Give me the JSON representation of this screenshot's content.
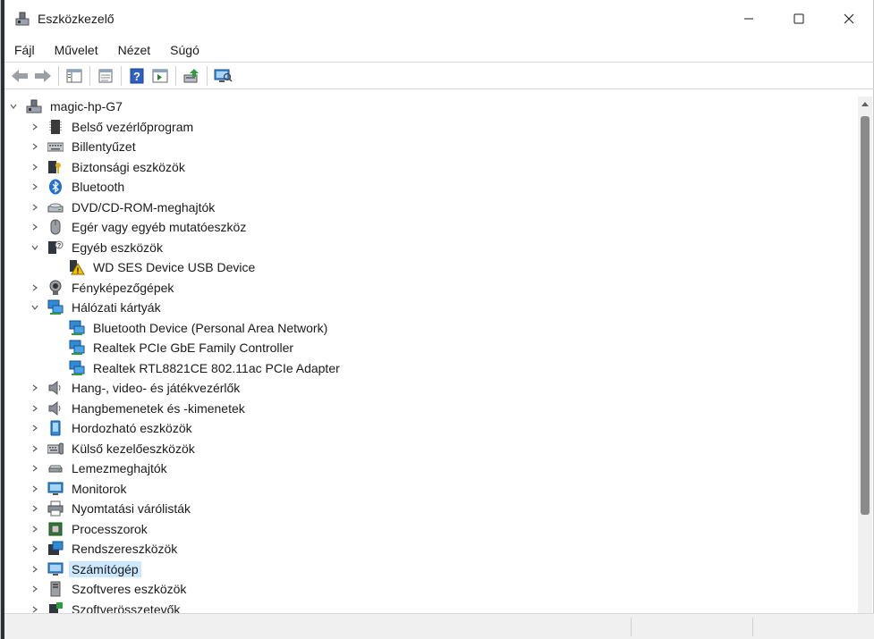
{
  "window": {
    "title": "Eszközkezelő",
    "icon": "device-manager-icon"
  },
  "window_controls": [
    "minimize-icon",
    "maximize-icon",
    "close-icon"
  ],
  "menu": [
    {
      "label": "Fájl"
    },
    {
      "label": "Művelet"
    },
    {
      "label": "Nézet"
    },
    {
      "label": "Súgó"
    }
  ],
  "toolbar": [
    "back-arrow-icon",
    "forward-arrow-icon",
    "show-hide-console-tree-icon",
    "properties-icon",
    "help-icon",
    "action-pane-icon",
    "update-driver-icon",
    "scan-hardware-icon"
  ],
  "tree": {
    "root": {
      "label": "magic-hp-G7",
      "expanded": true
    },
    "items": [
      {
        "label": "Belső vezérlőprogram",
        "icon": "firmware-chip-icon",
        "level": 1,
        "expandable": true,
        "expanded": false
      },
      {
        "label": "Billentyűzet",
        "icon": "keyboard-icon",
        "level": 1,
        "expandable": true,
        "expanded": false
      },
      {
        "label": "Biztonsági eszközök",
        "icon": "security-key-icon",
        "level": 1,
        "expandable": true,
        "expanded": false
      },
      {
        "label": "Bluetooth",
        "icon": "bluetooth-icon",
        "level": 1,
        "expandable": true,
        "expanded": false
      },
      {
        "label": "DVD/CD-ROM-meghajtók",
        "icon": "dvd-drive-icon",
        "level": 1,
        "expandable": true,
        "expanded": false
      },
      {
        "label": "Egér vagy egyéb mutatóeszköz",
        "icon": "mouse-icon",
        "level": 1,
        "expandable": true,
        "expanded": false
      },
      {
        "label": "Egyéb eszközök",
        "icon": "unknown-device-icon",
        "level": 1,
        "expandable": true,
        "expanded": true
      },
      {
        "label": "WD SES Device USB Device",
        "icon": "warning-device-icon",
        "level": 2,
        "expandable": false,
        "expanded": false
      },
      {
        "label": "Fényképezőgépek",
        "icon": "webcam-icon",
        "level": 1,
        "expandable": true,
        "expanded": false
      },
      {
        "label": "Hálózati kártyák",
        "icon": "network-adapter-icon",
        "level": 1,
        "expandable": true,
        "expanded": true
      },
      {
        "label": "Bluetooth Device (Personal Area Network)",
        "icon": "network-adapter-icon",
        "level": 2,
        "expandable": false,
        "expanded": false
      },
      {
        "label": "Realtek PCIe GbE Family Controller",
        "icon": "network-adapter-icon",
        "level": 2,
        "expandable": false,
        "expanded": false
      },
      {
        "label": "Realtek RTL8821CE 802.11ac PCIe Adapter",
        "icon": "network-adapter-icon",
        "level": 2,
        "expandable": false,
        "expanded": false
      },
      {
        "label": "Hang-, video- és játékvezérlők",
        "icon": "speaker-icon",
        "level": 1,
        "expandable": true,
        "expanded": false
      },
      {
        "label": "Hangbemenetek és -kimenetek",
        "icon": "speaker-icon",
        "level": 1,
        "expandable": true,
        "expanded": false
      },
      {
        "label": "Hordozható eszközök",
        "icon": "portable-device-icon",
        "level": 1,
        "expandable": true,
        "expanded": false
      },
      {
        "label": "Külső kezelőeszközök",
        "icon": "human-interface-icon",
        "level": 1,
        "expandable": true,
        "expanded": false
      },
      {
        "label": "Lemezmeghajtók",
        "icon": "disk-drive-icon",
        "level": 1,
        "expandable": true,
        "expanded": false
      },
      {
        "label": "Monitorok",
        "icon": "monitor-icon",
        "level": 1,
        "expandable": true,
        "expanded": false
      },
      {
        "label": "Nyomtatási várólisták",
        "icon": "printer-icon",
        "level": 1,
        "expandable": true,
        "expanded": false
      },
      {
        "label": "Processzorok",
        "icon": "processor-icon",
        "level": 1,
        "expandable": true,
        "expanded": false
      },
      {
        "label": "Rendszereszközök",
        "icon": "system-devices-icon",
        "level": 1,
        "expandable": true,
        "expanded": false
      },
      {
        "label": "Számítógép",
        "icon": "computer-icon",
        "level": 1,
        "expandable": true,
        "expanded": false,
        "selected": true
      },
      {
        "label": "Szoftveres eszközök",
        "icon": "software-device-icon",
        "level": 1,
        "expandable": true,
        "expanded": false
      },
      {
        "label": "Szoftverösszetevők",
        "icon": "software-component-icon",
        "level": 1,
        "expandable": true,
        "expanded": false
      }
    ]
  },
  "colors": {
    "selection": "#cce8ff",
    "accent": "#1f6fd6",
    "network": "#2e8bd6"
  }
}
